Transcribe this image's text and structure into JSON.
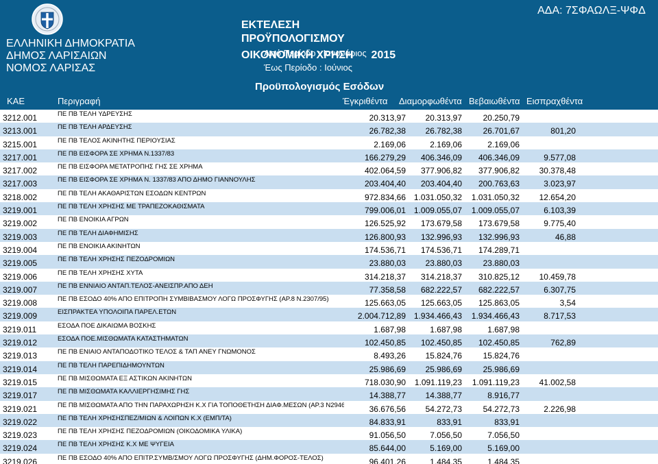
{
  "header": {
    "issuer_lines": [
      "ΕΛΛΗΝΙΚΗ ΔΗΜΟΚΡΑΤΙΑ",
      "ΔΗΜΟΣ ΛΑΡΙΣΑΙΩΝ",
      "ΝΟΜΟΣ ΛΑΡΙΣΑΣ"
    ],
    "title": "ΕΚΤΕΛΕΣΗ ΠΡΟΫΠΟΛΟΓΙΣΜΟΥ",
    "fiscal_label": "ΟΙΚΟΝΟΜΙΚΗ ΧΡΗΣΗ",
    "fiscal_year": "2015",
    "period_from": "Από Περίοδο : Ιανουάριος",
    "period_to": "Έως Περίοδο : Ιούνιος",
    "ada": "ΑΔΑ: 7ΣΦΑΩΛΞ-ΨΦΔ",
    "subtitle": "Προϋπολογισμός Εσόδων"
  },
  "columns": {
    "code": "ΚΑΕ",
    "description": "Περιγραφή",
    "approved": "Έγκριθέντα",
    "formed": "Διαμορφωθέντα",
    "certified": "Βεβαιωθέντα",
    "collected": "Εισπραχθέντα"
  },
  "rows": [
    {
      "code": "3212.001",
      "desc": "ΠΕ ΠΒ ΤΕΛΗ ΥΔΡΕΥΣΗΣ",
      "a": "20.313,97",
      "b": "20.313,97",
      "c": "20.250,79",
      "d": ""
    },
    {
      "code": "3213.001",
      "desc": "ΠΕ ΠΒ ΤΕΛΗ ΑΡΔΕΥΣΗΣ",
      "a": "26.782,38",
      "b": "26.782,38",
      "c": "26.701,67",
      "d": "801,20"
    },
    {
      "code": "3215.001",
      "desc": "ΠΕ ΠΒ ΤΕΛΟΣ ΑΚΙΝΗΤΗΣ ΠΕΡΙΟΥΣΙΑΣ",
      "a": "2.169,06",
      "b": "2.169,06",
      "c": "2.169,06",
      "d": ""
    },
    {
      "code": "3217.001",
      "desc": "ΠΕ ΠΒ ΕΙΣΦΟΡΑ ΣΕ ΧΡΗΜΑ Ν.1337/83",
      "a": "166.279,29",
      "b": "406.346,09",
      "c": "406.346,09",
      "d": "9.577,08"
    },
    {
      "code": "3217.002",
      "desc": "ΠΕ ΠΒ ΕΙΣΦΟΡΑ ΜΕΤΑΤΡΟΠΗΣ ΓΗΣ ΣΕ ΧΡΗΜΑ",
      "a": "402.064,59",
      "b": "377.906,82",
      "c": "377.906,82",
      "d": "30.378,48"
    },
    {
      "code": "3217.003",
      "desc": "ΠΕ ΠΒ ΕΙΣΦΟΡΑ ΣΕ ΧΡΗΜΑ Ν. 1337/83 ΑΠΟ ΔΗΜΟ ΓΙΑΝΝΟΥΛΗΣ",
      "a": "203.404,40",
      "b": "203.404,40",
      "c": "200.763,63",
      "d": "3.023,97"
    },
    {
      "code": "3218.002",
      "desc": "ΠΕ ΠΒ ΤΕΛΗ ΑΚΑΘΑΡΙΣΤΩΝ ΕΣΟΔΩΝ ΚΕΝΤΡΩΝ",
      "a": "972.834,66",
      "b": "1.031.050,32",
      "c": "1.031.050,32",
      "d": "12.654,20"
    },
    {
      "code": "3219.001",
      "desc": "ΠΕ ΠΒ ΤΕΛΗ ΧΡΗΣΗΣ ΜΕ ΤΡΑΠΕΖΟΚΑΘΙΣΜΑΤΑ",
      "a": "799.006,01",
      "b": "1.009.055,07",
      "c": "1.009.055,07",
      "d": "6.103,39"
    },
    {
      "code": "3219.002",
      "desc": "ΠΕ ΠΒ ΕΝΟΙΚΙΑ ΑΓΡΩΝ",
      "a": "126.525,92",
      "b": "173.679,58",
      "c": "173.679,58",
      "d": "9.775,40"
    },
    {
      "code": "3219.003",
      "desc": "ΠΕ ΠΒ ΤΕΛΗ ΔΙΑΦΗΜΙΣΗΣ",
      "a": "126.800,93",
      "b": "132.996,93",
      "c": "132.996,93",
      "d": "46,88"
    },
    {
      "code": "3219.004",
      "desc": "ΠΕ ΠΒ ΕΝΟΙΚΙΑ ΑΚΙΝΗΤΩΝ",
      "a": "174.536,71",
      "b": "174.536,71",
      "c": "174.289,71",
      "d": ""
    },
    {
      "code": "3219.005",
      "desc": "ΠΕ ΠΒ ΤΕΛΗ ΧΡΗΣΗΣ ΠΕΖΟΔΡΟΜΙΩΝ",
      "a": "23.880,03",
      "b": "23.880,03",
      "c": "23.880,03",
      "d": ""
    },
    {
      "code": "3219.006",
      "desc": "ΠΕ ΠΒ ΤΕΛΗ ΧΡΗΣΗΣ ΧΥΤΑ",
      "a": "314.218,37",
      "b": "314.218,37",
      "c": "310.825,12",
      "d": "10.459,78"
    },
    {
      "code": "3219.007",
      "desc": "ΠΕ ΠΒ ΕΝΝΙΑΙΟ ΑΝΤΑΠ.ΤΕΛΟΣ-ΑΝΕΙΣΠΡ.ΑΠΟ ΔΕΗ",
      "a": "77.358,58",
      "b": "682.222,57",
      "c": "682.222,57",
      "d": "6.307,75"
    },
    {
      "code": "3219.008",
      "desc": "ΠΕ ΠΒ ΕΣΟΔΟ 40% ΑΠΟ ΕΠΙΤΡΟΠΗ ΣΥΜΒΙΒΑΣΜΟΥ ΛΟΓΩ ΠΡΟΣΦΥΓΗΣ (ΑΡ.8 Ν.2307/95)",
      "a": "125.663,05",
      "b": "125.663,05",
      "c": "125.863,05",
      "d": "3,54"
    },
    {
      "code": "3219.009",
      "desc": "ΕΙΣΠΡΑΚΤΕΑ ΥΠΟΛΟΙΠΑ ΠΑΡΕΛ.ΕΤΩΝ",
      "a": "2.004.712,89",
      "b": "1.934.466,43",
      "c": "1.934.466,43",
      "d": "8.717,53"
    },
    {
      "code": "3219.011",
      "desc": "ΕΣΟΔΑ ΠΟΕ ΔΙΚΑΙΩΜΑ ΒΟΣΚΗΣ",
      "a": "1.687,98",
      "b": "1.687,98",
      "c": "1.687,98",
      "d": ""
    },
    {
      "code": "3219.012",
      "desc": "ΕΣΟΔΑ ΠΟΕ.ΜΙΣΘΩΜΑΤΑ ΚΑΤΑΣΤΗΜΑΤΩΝ",
      "a": "102.450,85",
      "b": "102.450,85",
      "c": "102.450,85",
      "d": "762,89"
    },
    {
      "code": "3219.013",
      "desc": "ΠΕ ΠΒ ΕΝΙΑΙΟ ΑΝΤΑΠΟΔΟΤΙΚΟ ΤΕΛΟΣ & ΤΑΠ ΑΝΕΥ ΓΝΩΜΟΝΟΣ",
      "a": "8.493,26",
      "b": "15.824,76",
      "c": "15.824,76",
      "d": ""
    },
    {
      "code": "3219.014",
      "desc": "ΠΕ ΠΒ ΤΕΛΗ ΠΑΡΕΠΙΔΗΜΟΥΝΤΩΝ",
      "a": "25.986,69",
      "b": "25.986,69",
      "c": "25.986,69",
      "d": ""
    },
    {
      "code": "3219.015",
      "desc": "ΠΕ ΠΒ ΜΙΣΘΩΜΑΤΑ ΕΞ ΑΣΤΙΚΩΝ ΑΚΙΝΗΤΩΝ",
      "a": "718.030,90",
      "b": "1.091.119,23",
      "c": "1.091.119,23",
      "d": "41.002,58"
    },
    {
      "code": "3219.017",
      "desc": "ΠΕ ΠΒ ΜΙΣΘΩΜΑΤΑ ΚΑΛΛΙΕΡΓΗΣΙΜΗΣ ΓΗΣ",
      "a": "14.388,77",
      "b": "14.388,77",
      "c": "8.916,77",
      "d": ""
    },
    {
      "code": "3219.021",
      "desc": "ΠΕ ΠΒ ΜΙΣΘΩΜΑΤΑ ΑΠΟ ΤΗΝ ΠΑΡΑΧΩΡΗΣΗ Κ.Χ ΓΙΑ ΤΟΠΟΘΕΤΗΣΗ ΔΙΑΦ.ΜΕΣΩΝ (ΑΡ.3 Ν2946/",
      "a": "36.676,56",
      "b": "54.272,73",
      "c": "54.272,73",
      "d": "2.226,98"
    },
    {
      "code": "3219.022",
      "desc": "ΠΕ ΠΒ ΤΕΛΗ ΧΡΗΣΗΣΠΕΖ/ΜΙΩΝ & ΛΟΙΠΩΝ Κ.Χ (ΕΜΠ/ΤΑ)",
      "a": "84.833,91",
      "b": "833,91",
      "c": "833,91",
      "d": ""
    },
    {
      "code": "3219.023",
      "desc": "ΠΕ ΠΒ ΤΕΛΗ ΧΡΗΣΗΣ ΠΕΖΟΔΡΟΜΙΩΝ (ΟΙΚΟΔΟΜΙΚΑ ΥΛΙΚΑ)",
      "a": "91.056,50",
      "b": "7.056,50",
      "c": "7.056,50",
      "d": ""
    },
    {
      "code": "3219.024",
      "desc": "ΠΕ ΠΒ ΤΕΛΗ ΧΡΗΣΗΣ Κ.Χ ΜΕ ΨΥΓΕΙΑ",
      "a": "85.644,00",
      "b": "5.169,00",
      "c": "5.169,00",
      "d": ""
    },
    {
      "code": "3219.026",
      "desc": "ΠΕ ΠΒ ΕΣΟΔΟ 40% ΑΠΟ ΕΠΙΤΡ.ΣΥΜΒ/ΣΜΟΥ ΛΟΓΩ ΠΡΟΣΦΥΓΗΣ (ΔΗΜ.ΦΟΡΟΣ-ΤΕΛΟΣ)",
      "a": "96.401,26",
      "b": "1.484,35",
      "c": "1.484,35",
      "d": ""
    }
  ]
}
